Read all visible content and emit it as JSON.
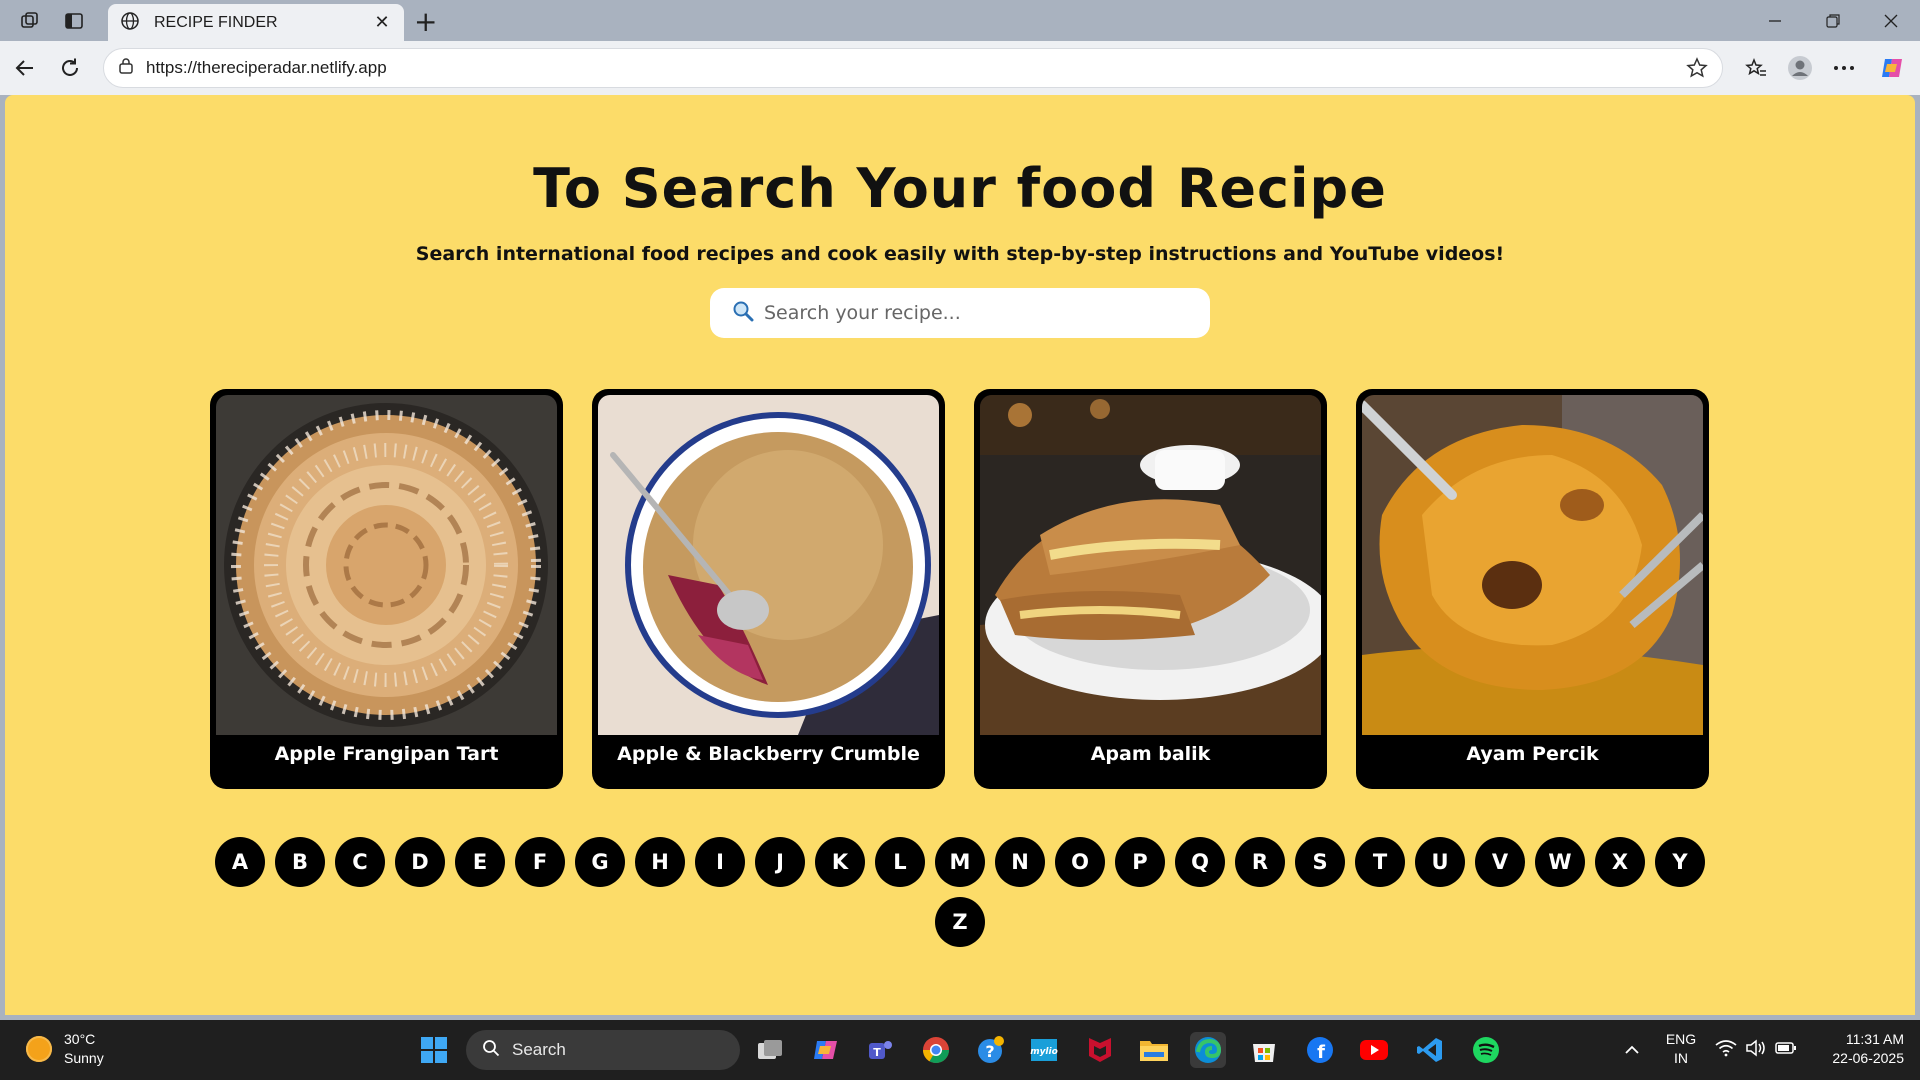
{
  "browser": {
    "tab_title": "RECIPE FINDER",
    "url": "https://thereciperadar.netlify.app",
    "new_tab_label": "+"
  },
  "page": {
    "title": "To Search Your food Recipe",
    "subtitle": "Search international food recipes and cook easily with step-by-step instructions and YouTube videos!",
    "search_placeholder": "Search your recipe...",
    "background_color": "#fcdc69"
  },
  "recipes": [
    {
      "name": "Apple Frangipan Tart",
      "image": "apple-tart-photo"
    },
    {
      "name": "Apple & Blackberry Crumble",
      "image": "crumble-photo"
    },
    {
      "name": "Apam balik",
      "image": "apam-balik-photo"
    },
    {
      "name": "Ayam Percik",
      "image": "ayam-percik-photo"
    }
  ],
  "letters": [
    "A",
    "B",
    "C",
    "D",
    "E",
    "F",
    "G",
    "H",
    "I",
    "J",
    "K",
    "L",
    "M",
    "N",
    "O",
    "P",
    "Q",
    "R",
    "S",
    "T",
    "U",
    "V",
    "W",
    "X",
    "Y",
    "Z"
  ],
  "taskbar": {
    "weather_temp": "30°C",
    "weather_desc": "Sunny",
    "search_label": "Search",
    "lang_top": "ENG",
    "lang_bottom": "IN",
    "time": "11:31 AM",
    "date": "22-06-2025"
  }
}
